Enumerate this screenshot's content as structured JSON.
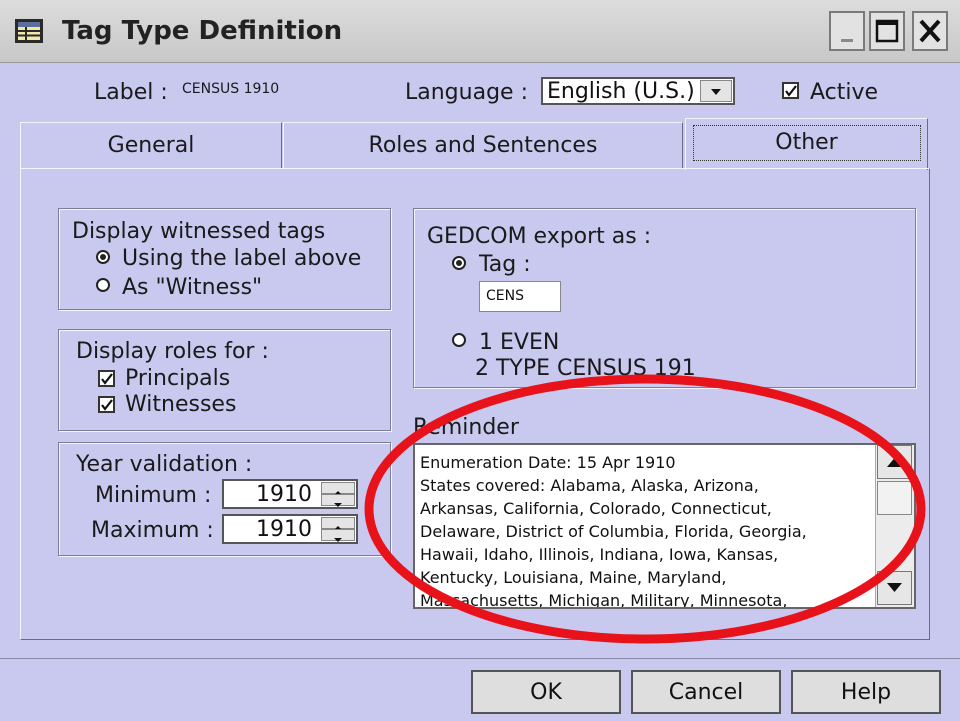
{
  "window": {
    "title": "Tag Type Definition",
    "icon": "table-icon",
    "controls": {
      "minimize": "minimize-icon",
      "maximize": "maximize-icon",
      "close": "close-icon"
    }
  },
  "header": {
    "label_caption": "Label :",
    "label_value": "CENSUS 1910",
    "language_caption": "Language :",
    "language_value": "English (U.S.)",
    "active_label": "Active",
    "active_checked": true
  },
  "tabs": [
    {
      "label": "General",
      "selected": false
    },
    {
      "label": "Roles and Sentences",
      "selected": false
    },
    {
      "label": "Other",
      "selected": true
    }
  ],
  "witnessed": {
    "title": "Display witnessed tags",
    "options": [
      {
        "label": "Using the label above",
        "selected": true
      },
      {
        "label": "As \"Witness\"",
        "selected": false
      }
    ]
  },
  "roles": {
    "title": "Display roles for :",
    "options": [
      {
        "label": "Principals",
        "checked": true
      },
      {
        "label": "Witnesses",
        "checked": true
      }
    ]
  },
  "year": {
    "title": "Year validation :",
    "minimum_label": "Minimum :",
    "minimum_value": "1910",
    "maximum_label": "Maximum :",
    "maximum_value": "1910"
  },
  "gedcom": {
    "title": "GEDCOM export as :",
    "tag_option": "Tag :",
    "tag_selected": true,
    "tag_value": "CENS",
    "alt_option_line1": "1 EVEN",
    "alt_option_line2": "2 TYPE CENSUS 191"
  },
  "reminder": {
    "title": "Reminder",
    "lines": [
      "Enumeration Date: 15 Apr 1910",
      "States covered: Alabama, Alaska, Arizona,",
      "Arkansas, California, Colorado, Connecticut,",
      "Delaware, District of Columbia, Florida, Georgia,",
      "Hawaii, Idaho, Illinois, Indiana, Iowa, Kansas,",
      "Kentucky, Louisiana, Maine, Maryland,",
      "Massachusetts, Michigan, Military, Minnesota,"
    ]
  },
  "buttons": {
    "ok": "OK",
    "cancel": "Cancel",
    "help": "Help"
  },
  "annotation": {
    "color": "#e8121b"
  }
}
